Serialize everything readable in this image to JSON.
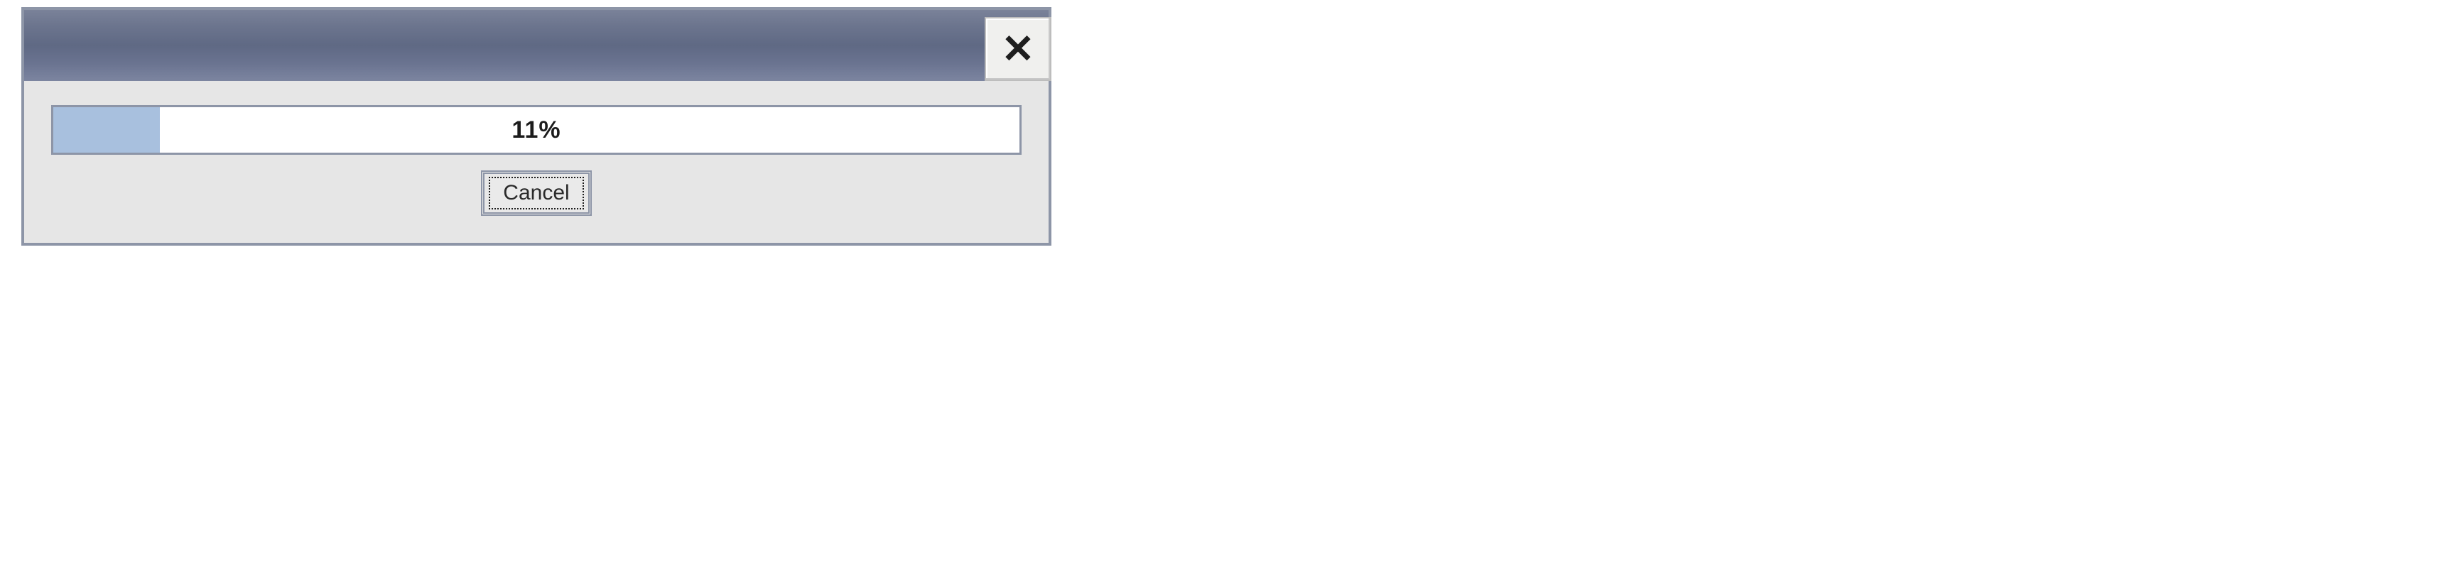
{
  "dialog": {
    "close_glyph": "✕",
    "progress": {
      "percent": 11,
      "label": "11%"
    },
    "cancel_label": "Cancel"
  }
}
